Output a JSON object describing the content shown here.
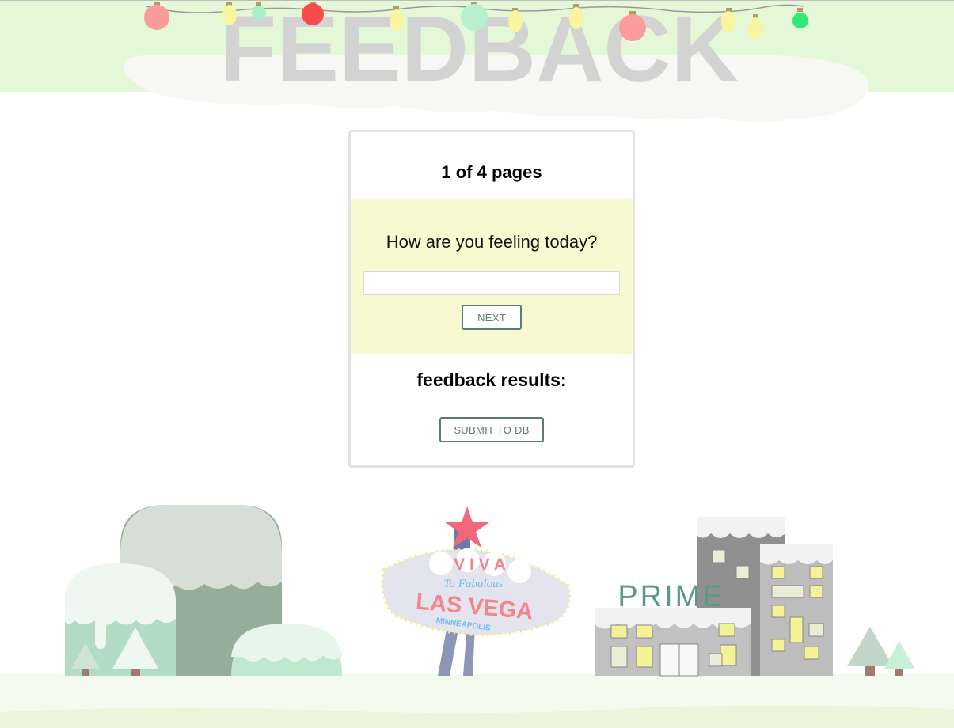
{
  "header": {
    "title": "FEEDBACK"
  },
  "card": {
    "page_indicator": "1 of 4 pages",
    "question": "How are you feeling today?",
    "answer_value": "",
    "answer_placeholder": "",
    "next_label": "NEXT",
    "results_heading": "feedback results:",
    "submit_label": "SUBMIT TO DB"
  },
  "scenery": {
    "sign_word_1": "V I V A",
    "sign_word_2": "To Fabulous",
    "sign_word_3": "LAS VEGA",
    "sign_word_4": "MINNEAPOLIS",
    "building_sign": "PRIME"
  },
  "colors": {
    "header_band": "#e4f8d8",
    "question_panel": "#f7f9d0",
    "button_border": "#5f7a73"
  }
}
